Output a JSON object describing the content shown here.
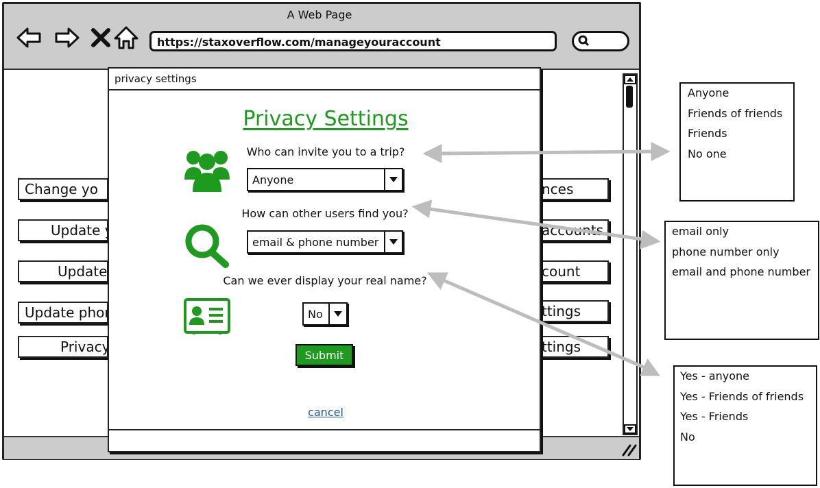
{
  "browser": {
    "title": "A Web Page",
    "url": "https://staxoverflow.com/manageyouraccount"
  },
  "background_buttons": {
    "left": [
      "Change yo",
      "Update y",
      "Update",
      "Update phon",
      "Privacy"
    ],
    "right": [
      "nces",
      "accounts",
      "count",
      "ttings",
      "ttings"
    ]
  },
  "modal": {
    "window_title": "privacy settings",
    "heading": "Privacy Settings",
    "q1": "Who can invite you to a trip?",
    "q1_value": "Anyone",
    "q2": "How can other users find you?",
    "q2_value": "email & phone number",
    "q3": "Can we ever display your real name?",
    "q3_value": "No",
    "submit": "Submit",
    "cancel": "cancel"
  },
  "option_lists": {
    "invite": [
      "Anyone",
      "Friends of friends",
      "Friends",
      "No one"
    ],
    "find": [
      "email only",
      "phone number only",
      "email and phone number"
    ],
    "real_name": [
      "Yes - anyone",
      "Yes - Friends of friends",
      "Yes - Friends",
      "No"
    ]
  },
  "colors": {
    "accent_green": "#1e9b1e",
    "link_blue": "#1a55a0",
    "chrome_gray": "#cccccc"
  }
}
